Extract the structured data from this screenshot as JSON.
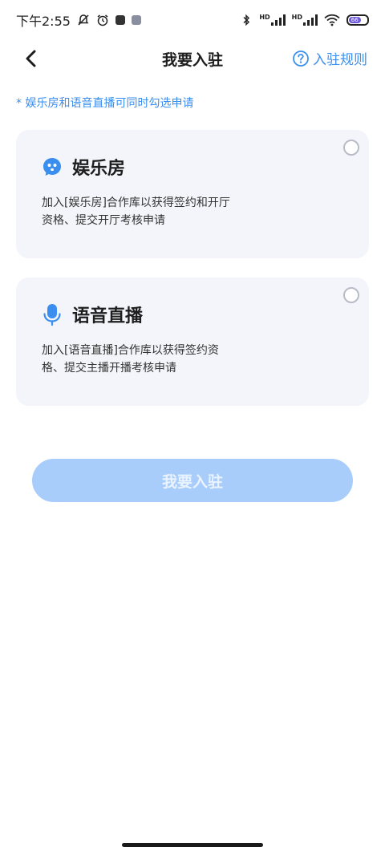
{
  "status_bar": {
    "time": "下午2:55",
    "battery_level": "66",
    "icons": [
      "mute-bell-icon",
      "alarm-icon",
      "app-notification-icon",
      "app-notification-icon-2",
      "bluetooth-icon",
      "signal-icon",
      "signal-icon-2",
      "wifi-icon",
      "battery-icon"
    ]
  },
  "header": {
    "title": "我要入驻",
    "back_icon": "chevron-left-icon",
    "rules_label": "入驻规则",
    "rules_icon": "question-circle-icon"
  },
  "tip": "* 娱乐房和语音直播可同时勾选申请",
  "options": [
    {
      "title": "娱乐房",
      "desc": "加入[娱乐房]合作库以获得签约和开厅资格、提交开厅考核申请",
      "icon": "chat-face-icon"
    },
    {
      "title": "语音直播",
      "desc": "加入[语音直播]合作库以获得签约资格、提交主播开播考核申请",
      "icon": "microphone-icon"
    }
  ],
  "submit_label": "我要入驻",
  "colors": {
    "accent": "#3a8ef0",
    "button_disabled": "#a8cdfb",
    "card_bg": "#f4f5fa"
  }
}
